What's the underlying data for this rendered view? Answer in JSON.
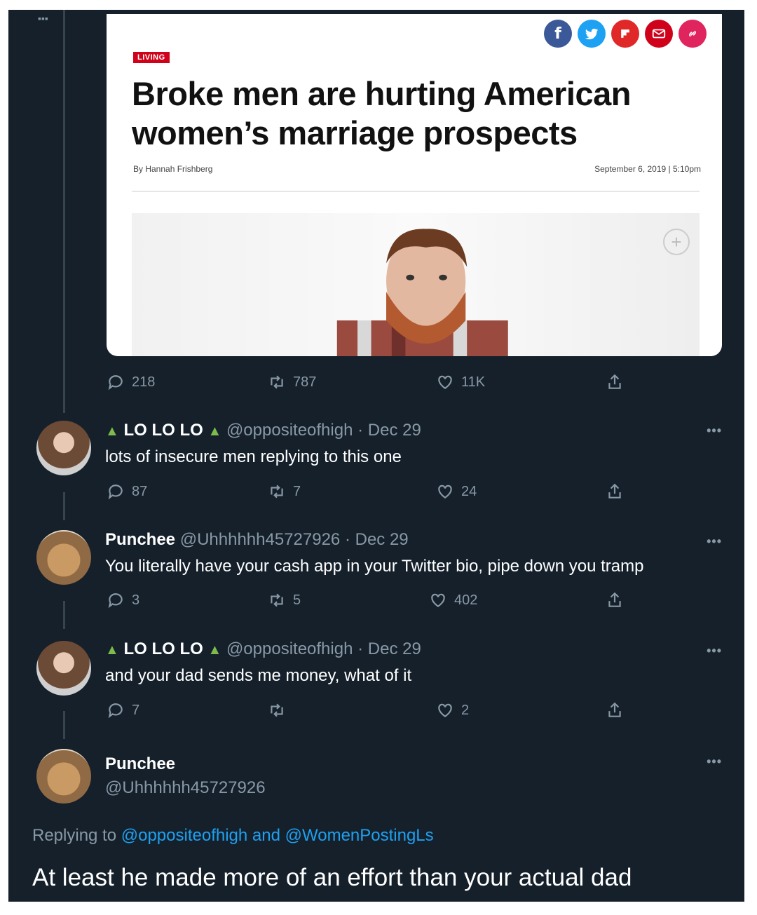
{
  "article": {
    "section_tag": "LIVING",
    "headline": "Broke men are hurting American women’s marriage prospects",
    "byline": "By Hannah Frishberg",
    "date": "September 6, 2019  |  5:10pm",
    "share_icons": [
      "facebook-icon",
      "twitter-icon",
      "flipboard-icon",
      "email-icon",
      "link-icon"
    ],
    "colors": {
      "facebook": "#3b5998",
      "twitter": "#1da1f2",
      "flipboard": "#e12828",
      "email": "#d0021b",
      "link": "#e0245e"
    }
  },
  "main_tweet": {
    "replies": "218",
    "retweets": "787",
    "likes": "11K"
  },
  "tweets": [
    {
      "display_name": "LO  LO  LO",
      "handle": "@oppositeofhigh",
      "date": "Dec 29",
      "text": "lots of insecure men replying to this one",
      "replies": "87",
      "retweets": "7",
      "likes": "24"
    },
    {
      "display_name": "Punchee",
      "handle": "@Uhhhhhh45727926",
      "date": "Dec 29",
      "text": "You literally have your cash app in your Twitter bio, pipe down you tramp",
      "replies": "3",
      "retweets": "5",
      "likes": "402"
    },
    {
      "display_name": "LO  LO  LO",
      "handle": "@oppositeofhigh",
      "date": "Dec 29",
      "text": "and your dad sends me money, what of it",
      "replies": "7",
      "retweets": "",
      "likes": "2"
    }
  ],
  "focused_tweet": {
    "display_name": "Punchee",
    "handle": "@Uhhhhhh45727926",
    "replying_prefix": "Replying to",
    "mention_1": "@oppositeofhigh",
    "and_word": "and",
    "mention_2": "@WomenPostingLs",
    "text": "At least he made more of an effort than your actual dad"
  },
  "theme": {
    "background": "#15202b",
    "muted": "#8899a6",
    "accent": "#1da1f2"
  }
}
